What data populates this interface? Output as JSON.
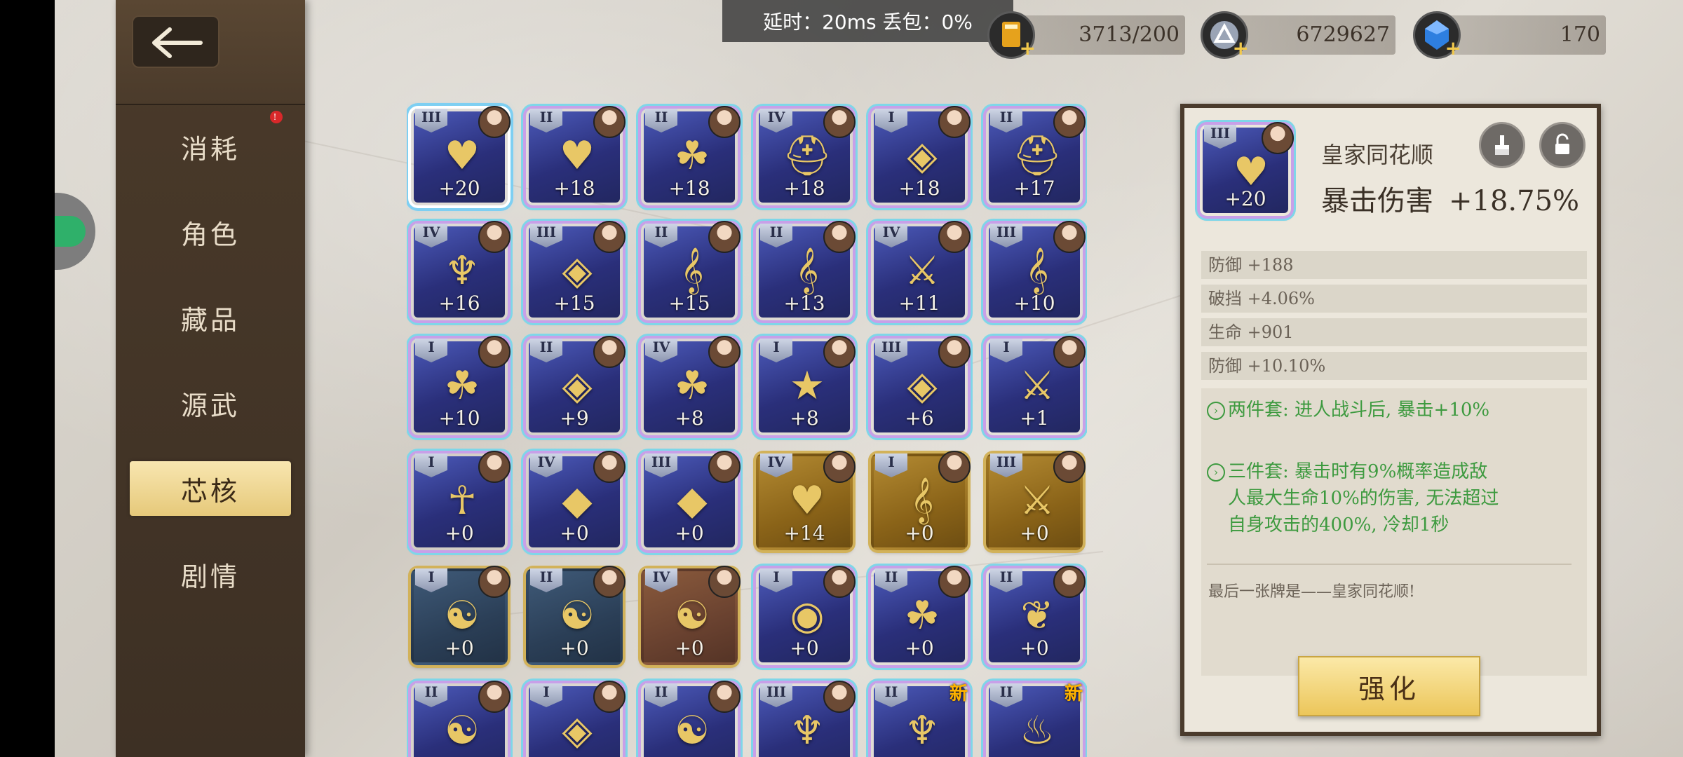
{
  "status": {
    "latency_label": "延时：20ms 丢包：0%"
  },
  "resources": [
    {
      "icon": "stamina-icon",
      "value": "3713/200",
      "color": "#e6a21c"
    },
    {
      "icon": "silver-coin-icon",
      "value": "6729627",
      "color": "#9aa4b5"
    },
    {
      "icon": "blue-crystal-icon",
      "value": "170",
      "color": "#2e7fe0"
    }
  ],
  "sidebar": {
    "back_icon": "back-arrow-icon",
    "items": [
      {
        "label": "消耗",
        "badge": "!"
      },
      {
        "label": "角色"
      },
      {
        "label": "藏品"
      },
      {
        "label": "源武"
      },
      {
        "label": "芯核",
        "active": true
      },
      {
        "label": "剧情"
      }
    ]
  },
  "grid": {
    "items": [
      {
        "tier": "III",
        "level": "+20",
        "icon": "poker-card-heart-icon",
        "style": "rainbow",
        "selected": true
      },
      {
        "tier": "II",
        "level": "+18",
        "icon": "poker-card-heart-icon",
        "style": "rainbow"
      },
      {
        "tier": "II",
        "level": "+18",
        "icon": "four-leaf-clover-icon",
        "style": "rainbow"
      },
      {
        "tier": "IV",
        "level": "+18",
        "icon": "knight-helmet-icon",
        "style": "rainbow"
      },
      {
        "tier": "I",
        "level": "+18",
        "icon": "jade-coin-icon",
        "style": "rainbow"
      },
      {
        "tier": "II",
        "level": "+17",
        "icon": "knight-helmet-icon",
        "style": "rainbow"
      },
      {
        "tier": "IV",
        "level": "+16",
        "icon": "tribal-mask-icon",
        "style": "rainbow"
      },
      {
        "tier": "III",
        "level": "+15",
        "icon": "jade-coin-icon",
        "style": "rainbow"
      },
      {
        "tier": "II",
        "level": "+15",
        "icon": "treble-clef-icon",
        "style": "rainbow"
      },
      {
        "tier": "II",
        "level": "+13",
        "icon": "treble-clef-icon",
        "style": "rainbow"
      },
      {
        "tier": "IV",
        "level": "+11",
        "icon": "sword-icon",
        "style": "rainbow"
      },
      {
        "tier": "III",
        "level": "+10",
        "icon": "treble-clef-icon",
        "style": "rainbow"
      },
      {
        "tier": "I",
        "level": "+10",
        "icon": "four-leaf-clover-icon",
        "style": "rainbow"
      },
      {
        "tier": "II",
        "level": "+9",
        "icon": "jade-coin-icon",
        "style": "rainbow"
      },
      {
        "tier": "IV",
        "level": "+8",
        "icon": "four-leaf-clover-icon",
        "style": "rainbow"
      },
      {
        "tier": "I",
        "level": "+8",
        "icon": "star-shield-icon",
        "style": "rainbow"
      },
      {
        "tier": "III",
        "level": "+6",
        "icon": "jade-coin-icon",
        "style": "rainbow"
      },
      {
        "tier": "I",
        "level": "+1",
        "icon": "sword-icon",
        "style": "rainbow"
      },
      {
        "tier": "I",
        "level": "+0",
        "icon": "anubis-icon",
        "style": "rainbow"
      },
      {
        "tier": "IV",
        "level": "+0",
        "icon": "crystal-spikes-icon",
        "style": "rainbow"
      },
      {
        "tier": "III",
        "level": "+0",
        "icon": "crystal-spikes-icon",
        "style": "rainbow"
      },
      {
        "tier": "IV",
        "level": "+14",
        "icon": "poker-card-heart-icon",
        "style": "gold"
      },
      {
        "tier": "I",
        "level": "+0",
        "icon": "treble-clef-icon",
        "style": "gold"
      },
      {
        "tier": "III",
        "level": "+0",
        "icon": "sword-icon",
        "style": "gold"
      },
      {
        "tier": "I",
        "level": "+0",
        "icon": "yin-yang-icon",
        "style": "slate"
      },
      {
        "tier": "II",
        "level": "+0",
        "icon": "yin-yang-icon",
        "style": "slate"
      },
      {
        "tier": "IV",
        "level": "+0",
        "icon": "yin-yang-icon",
        "style": "bronze"
      },
      {
        "tier": "I",
        "level": "+0",
        "icon": "roulette-icon",
        "style": "rainbow"
      },
      {
        "tier": "II",
        "level": "+0",
        "icon": "four-leaf-clover-icon",
        "style": "rainbow"
      },
      {
        "tier": "II",
        "level": "+0",
        "icon": "heart-bow-icon",
        "style": "rainbow"
      },
      {
        "tier": "II",
        "level": "",
        "icon": "yin-yang-icon",
        "style": "rainbow"
      },
      {
        "tier": "I",
        "level": "",
        "icon": "jade-coin-icon",
        "style": "rainbow"
      },
      {
        "tier": "II",
        "level": "",
        "icon": "yin-yang-icon",
        "style": "rainbow"
      },
      {
        "tier": "III",
        "level": "",
        "icon": "tribal-mask-icon",
        "style": "rainbow"
      },
      {
        "tier": "II",
        "level": "",
        "icon": "tribal-mask-icon",
        "style": "rainbow",
        "new": "新"
      },
      {
        "tier": "II",
        "level": "",
        "icon": "lantern-icon",
        "style": "rainbow",
        "new": "新"
      }
    ]
  },
  "detail": {
    "tier": "III",
    "level": "+20",
    "icon": "poker-card-heart-icon",
    "name": "皇家同花顺",
    "main_stat_label": "暴击伤害",
    "main_stat_value": "+18.75%",
    "broom_icon": "broom-icon",
    "lock_icon": "unlock-icon",
    "substats": [
      "防御 +188",
      "破挡 +4.06%",
      "生命 +901",
      "防御 +10.10%"
    ],
    "set_two": "两件套:  进人战斗后, 暴击+10%",
    "set_three_l1": "三件套:  暴击时有9%概率造成敌",
    "set_three_l2": "人最大生命10%的伤害, 无法超过",
    "set_three_l3": "自身攻击的400%, 冷却1秒",
    "flavor": "最后一张牌是——皇家同花顺!",
    "enhance_label": "强化"
  }
}
